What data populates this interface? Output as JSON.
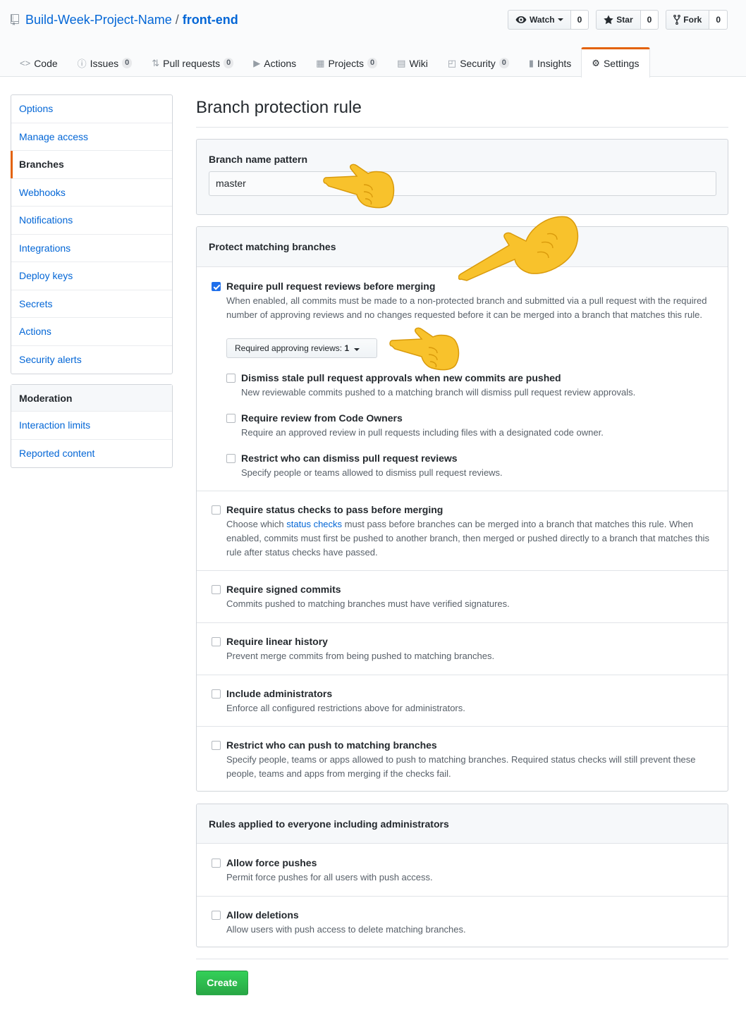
{
  "repo": {
    "owner": "Build-Week-Project-Name",
    "separator": "/",
    "name": "front-end"
  },
  "actions": {
    "watch": {
      "label": "Watch",
      "count": "0"
    },
    "star": {
      "label": "Star",
      "count": "0"
    },
    "fork": {
      "label": "Fork",
      "count": "0"
    }
  },
  "nav": {
    "code": {
      "label": "Code"
    },
    "issues": {
      "label": "Issues",
      "count": "0"
    },
    "pulls": {
      "label": "Pull requests",
      "count": "0"
    },
    "actions": {
      "label": "Actions"
    },
    "projects": {
      "label": "Projects",
      "count": "0"
    },
    "wiki": {
      "label": "Wiki"
    },
    "security": {
      "label": "Security",
      "count": "0"
    },
    "insights": {
      "label": "Insights"
    },
    "settings": {
      "label": "Settings"
    }
  },
  "sidebar": {
    "items": [
      {
        "label": "Options"
      },
      {
        "label": "Manage access"
      },
      {
        "label": "Branches"
      },
      {
        "label": "Webhooks"
      },
      {
        "label": "Notifications"
      },
      {
        "label": "Integrations"
      },
      {
        "label": "Deploy keys"
      },
      {
        "label": "Secrets"
      },
      {
        "label": "Actions"
      },
      {
        "label": "Security alerts"
      }
    ],
    "moderation": {
      "heading": "Moderation",
      "items": [
        {
          "label": "Interaction limits"
        },
        {
          "label": "Reported content"
        }
      ]
    }
  },
  "page": {
    "title": "Branch protection rule",
    "pattern_label": "Branch name pattern",
    "pattern_value": "master",
    "protect_heading": "Protect matching branches",
    "rules_heading": "Rules applied to everyone including administrators",
    "create_label": "Create"
  },
  "options": {
    "reviews": {
      "title": "Require pull request reviews before merging",
      "desc": "When enabled, all commits must be made to a non-protected branch and submitted via a pull request with the required number of approving reviews and no changes requested before it can be merged into a branch that matches this rule.",
      "checked": true,
      "select_label": "Required approving reviews:",
      "select_value": "1"
    },
    "dismiss_stale": {
      "title": "Dismiss stale pull request approvals when new commits are pushed",
      "desc": "New reviewable commits pushed to a matching branch will dismiss pull request review approvals."
    },
    "code_owners": {
      "title": "Require review from Code Owners",
      "desc": "Require an approved review in pull requests including files with a designated code owner."
    },
    "restrict_dismiss": {
      "title": "Restrict who can dismiss pull request reviews",
      "desc": "Specify people or teams allowed to dismiss pull request reviews."
    },
    "status_checks": {
      "title": "Require status checks to pass before merging",
      "desc_before": "Choose which ",
      "desc_link": "status checks",
      "desc_after": " must pass before branches can be merged into a branch that matches this rule. When enabled, commits must first be pushed to another branch, then merged or pushed directly to a branch that matches this rule after status checks have passed."
    },
    "signed": {
      "title": "Require signed commits",
      "desc": "Commits pushed to matching branches must have verified signatures."
    },
    "linear": {
      "title": "Require linear history",
      "desc": "Prevent merge commits from being pushed to matching branches."
    },
    "admins": {
      "title": "Include administrators",
      "desc": "Enforce all configured restrictions above for administrators."
    },
    "restrict_push": {
      "title": "Restrict who can push to matching branches",
      "desc": "Specify people, teams or apps allowed to push to matching branches. Required status checks will still prevent these people, teams and apps from merging if the checks fail."
    },
    "force_push": {
      "title": "Allow force pushes",
      "desc": "Permit force pushes for all users with push access."
    },
    "deletions": {
      "title": "Allow deletions",
      "desc": "Allow users with push access to delete matching branches."
    }
  },
  "colors": {
    "link": "#0366d6",
    "accent_orange": "#e36209",
    "primary_green": "#28a745",
    "checkbox_blue": "#1f6feb"
  }
}
